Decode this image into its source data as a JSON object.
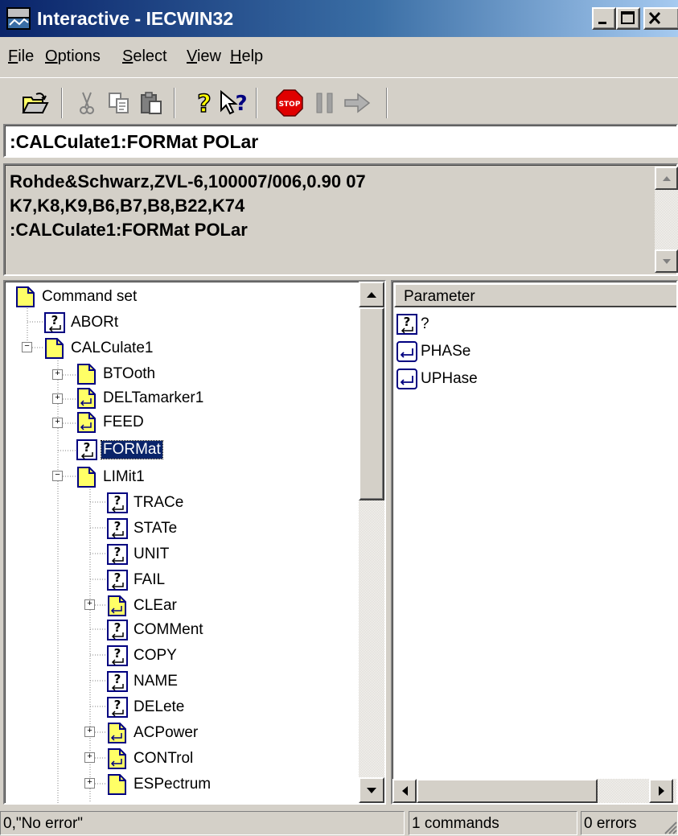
{
  "window": {
    "title": "Interactive - IECWIN32",
    "icon": "iecwin-app-icon",
    "caption_buttons": [
      "minimize-icon",
      "maximize-icon",
      "close-icon"
    ]
  },
  "menu": {
    "items": [
      {
        "label_first": "F",
        "label_rest": "ile"
      },
      {
        "label_first": "O",
        "label_rest": "ptions"
      },
      {
        "label_first": "S",
        "label_rest": "elect"
      },
      {
        "label_first": "V",
        "label_rest": "iew"
      },
      {
        "label_first": "H",
        "label_rest": "elp"
      }
    ]
  },
  "toolbar": {
    "buttons": [
      "open-folder-icon",
      "cut-icon",
      "copy-icon",
      "paste-icon",
      "help-icon",
      "context-help-icon",
      "stop-icon",
      "pause-icon",
      "run-arrow-icon"
    ],
    "stop_label": "STOP"
  },
  "command_input": {
    "value": ":CALCulate1:FORMat POLar"
  },
  "output": {
    "lines": [
      "Rohde&Schwarz,ZVL-6,100007/006,0.90 07",
      "K7,K8,K9,B6,B7,B8,B22,K74",
      ":CALCulate1:FORMat POLar"
    ]
  },
  "tree": {
    "root": "Command set",
    "nodes": [
      {
        "label": "ABORt",
        "icon": "query-command-icon"
      },
      {
        "label": "CALCulate1",
        "icon": "folder-icon"
      },
      {
        "label": "BTOoth",
        "icon": "folder-icon"
      },
      {
        "label": "DELTamarker1",
        "icon": "folder-setting-icon"
      },
      {
        "label": "FEED",
        "icon": "folder-setting-icon"
      },
      {
        "label": "FORMat",
        "icon": "query-command-icon",
        "selected": true
      },
      {
        "label": "LIMit1",
        "icon": "folder-icon"
      },
      {
        "label": "TRACe",
        "icon": "query-command-icon"
      },
      {
        "label": "STATe",
        "icon": "query-command-icon"
      },
      {
        "label": "UNIT",
        "icon": "query-command-icon"
      },
      {
        "label": "FAIL",
        "icon": "query-command-icon"
      },
      {
        "label": "CLEar",
        "icon": "folder-setting-icon"
      },
      {
        "label": "COMMent",
        "icon": "query-command-icon"
      },
      {
        "label": "COPY",
        "icon": "query-command-icon"
      },
      {
        "label": "NAME",
        "icon": "query-command-icon"
      },
      {
        "label": "DELete",
        "icon": "query-command-icon"
      },
      {
        "label": "ACPower",
        "icon": "folder-setting-icon"
      },
      {
        "label": "CONTrol",
        "icon": "folder-setting-icon"
      },
      {
        "label": "ESPectrum",
        "icon": "folder-icon"
      }
    ]
  },
  "parameters": {
    "header": "Parameter",
    "items": [
      {
        "label": "?",
        "icon": "query-icon"
      },
      {
        "label": "PHASe",
        "icon": "enter-icon"
      },
      {
        "label": "UPHase",
        "icon": "enter-icon"
      }
    ]
  },
  "status": {
    "message": "0,\"No error\"",
    "commands": "1 commands",
    "errors": "0 errors"
  },
  "colors": {
    "titlebar_start": "#0a246a",
    "titlebar_end": "#a6caf0",
    "face": "#d4d0c8",
    "folder_yellow": "#ffff66",
    "icon_blue": "#000080",
    "stop_red": "#e00000"
  }
}
